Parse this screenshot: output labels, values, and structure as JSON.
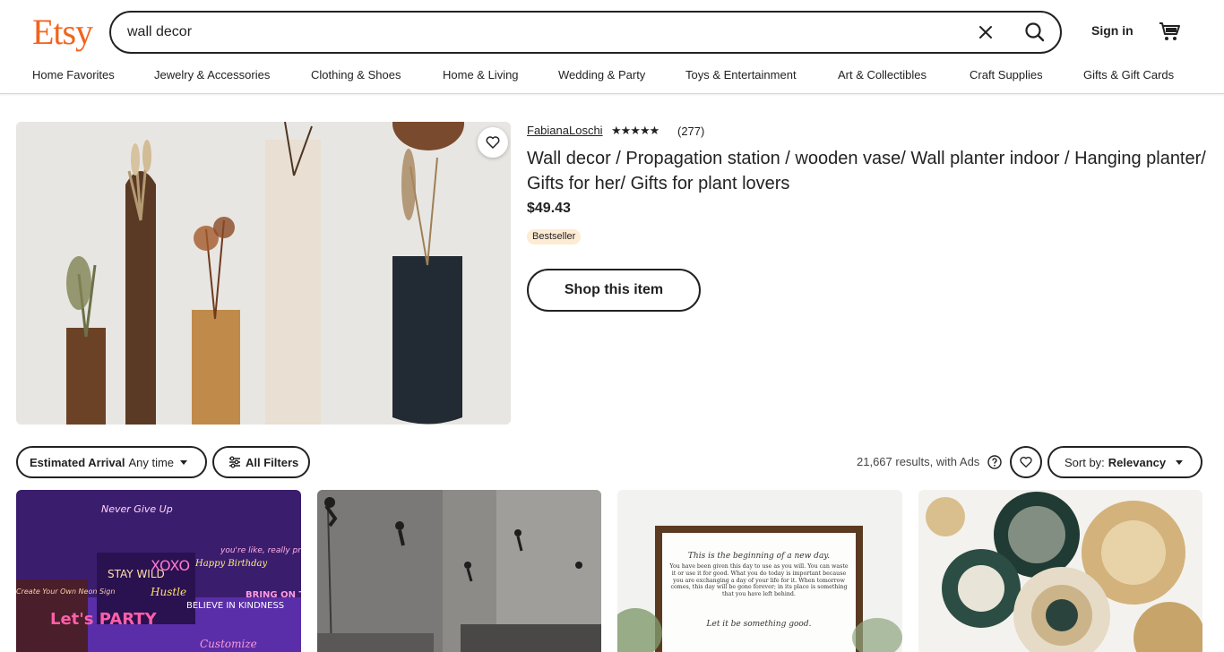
{
  "logo": "Etsy",
  "search": {
    "value": "wall decor"
  },
  "header": {
    "signin": "Sign in"
  },
  "nav": [
    "Home Favorites",
    "Jewelry & Accessories",
    "Clothing & Shoes",
    "Home & Living",
    "Wedding & Party",
    "Toys & Entertainment",
    "Art & Collectibles",
    "Craft Supplies",
    "Gifts & Gift Cards"
  ],
  "featured": {
    "shop": "FabianaLoschi",
    "rating_stars": "★★★★★",
    "rating": 5,
    "reviews": "(277)",
    "title": "Wall decor / Propagation station / wooden vase/ Wall planter indoor / Hanging planter/ Gifts for her/ Gifts for plant lovers",
    "price": "$49.43",
    "badge": "Bestseller",
    "cta": "Shop this item"
  },
  "filters": {
    "arrival_label": "Estimated Arrival",
    "arrival_value": "Any time",
    "all_filters": "All Filters",
    "results": "21,667 results, with Ads",
    "sort_label": "Sort by:",
    "sort_value": "Relevancy"
  },
  "grid_text": {
    "card1": [
      "Never Give Up",
      "STAY WILD",
      "XOXO",
      "Happy Birthday",
      "you're like, really pretty",
      "Let's PARTY",
      "Hustle",
      "BELIEVE IN KINDNESS",
      "BRING ON THE NIGHT",
      "Customize",
      "Create Your Own Neon Sign"
    ],
    "card3_heading": "This is the beginning of a new day.",
    "card3_body": "You have been given this day to use as you will. You can waste it or use it for good. What you do today is important because you are exchanging a day of your life for it. When tomorrow comes, this day will be gone forever; in its place is something that you have left behind.",
    "card3_footer": "Let it be something good."
  },
  "colors": {
    "brand": "#f1641e",
    "badge_bg": "#fdebd3",
    "text": "#222222"
  },
  "icons": [
    "clear-icon",
    "search-icon",
    "cart-icon",
    "heart-icon",
    "star-icon",
    "filter-icon",
    "help-icon",
    "caret-down-icon"
  ]
}
